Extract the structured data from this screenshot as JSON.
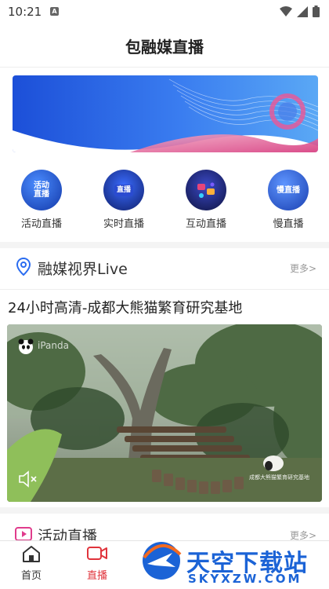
{
  "status_bar": {
    "time": "10:21",
    "badge": "A"
  },
  "header": {
    "title": "包融媒直播"
  },
  "categories": [
    {
      "label": "活动直播",
      "icon_text": "活动\n直播",
      "icon": "activity-live-icon",
      "color": "#2a6cf0"
    },
    {
      "label": "实时直播",
      "icon_text": "直播",
      "icon": "realtime-live-icon",
      "color": "#1f3fbf"
    },
    {
      "label": "互动直播",
      "icon_text": "",
      "icon": "interactive-live-icon",
      "color": "#1b2a7a"
    },
    {
      "label": "慢直播",
      "icon_text": "慢直播",
      "icon": "slow-live-icon",
      "color": "#2f6be8"
    }
  ],
  "section_live": {
    "title": "融媒视界Live",
    "more": "更多>"
  },
  "video": {
    "title": "24小时高清-成都大熊猫繁育研究基地",
    "watermark": "iPanda",
    "caption": "成都大熊猫繁育研究基地"
  },
  "section_activity": {
    "title": "活动直播",
    "more": "更多>"
  },
  "tabs": [
    {
      "label": "首页",
      "icon": "home-icon",
      "active": false
    },
    {
      "label": "直播",
      "icon": "live-camera-icon",
      "active": true
    }
  ],
  "site_watermark": {
    "main": "天空下载站",
    "sub": "SKYXZW.COM"
  },
  "colors": {
    "accent": "#e0343c",
    "blue": "#2a6cf0"
  }
}
